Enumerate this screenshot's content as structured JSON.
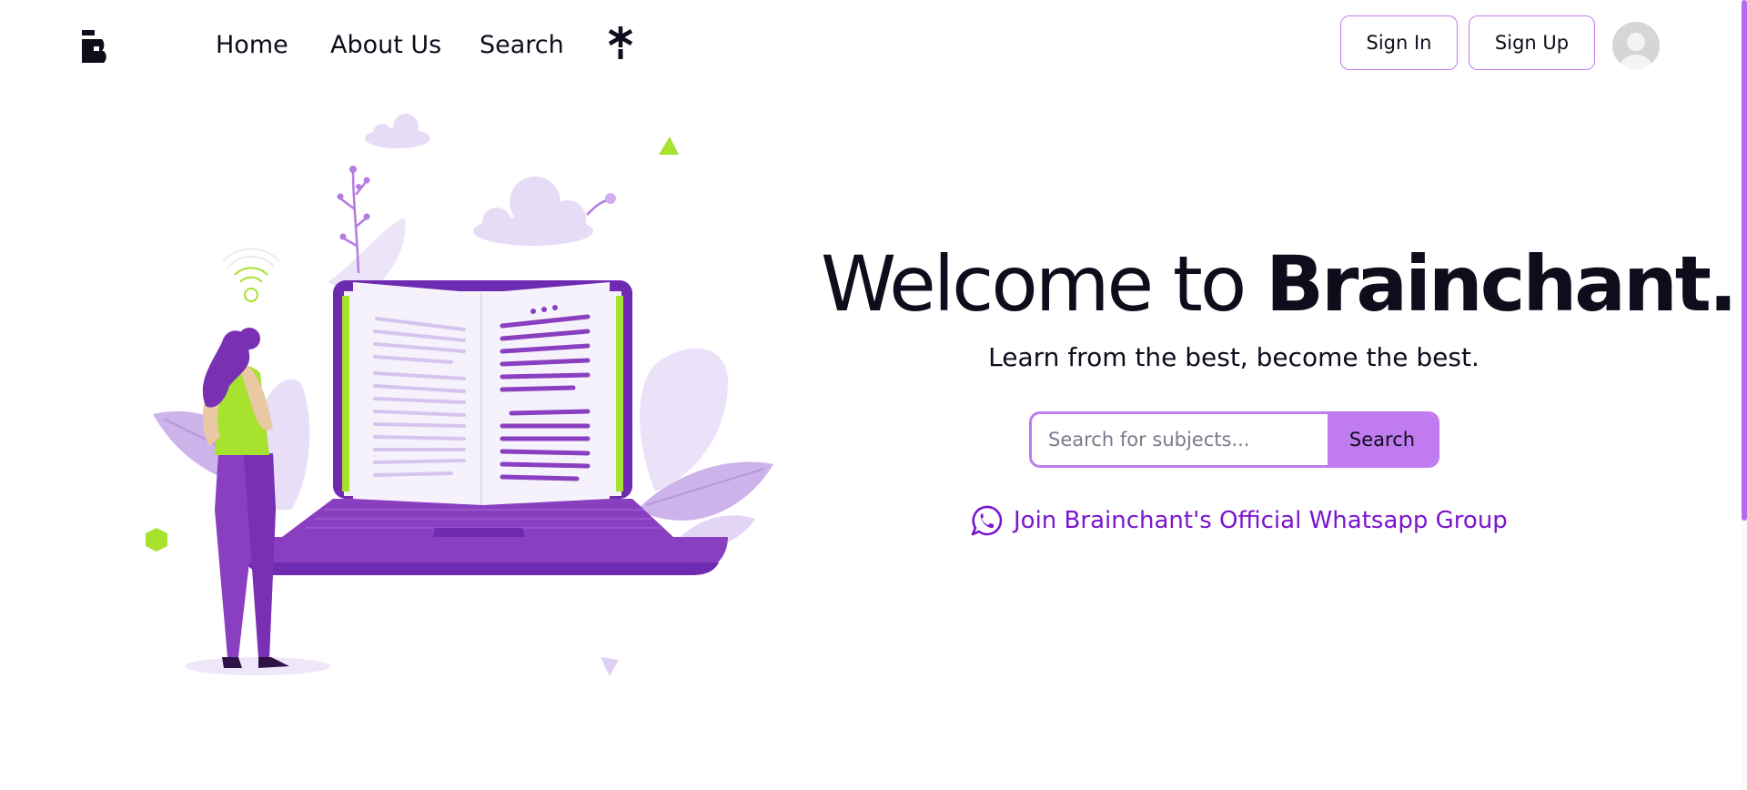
{
  "nav": {
    "home": "Home",
    "about": "About Us",
    "search": "Search"
  },
  "auth": {
    "sign_in": "Sign In",
    "sign_up": "Sign Up"
  },
  "hero": {
    "title_prefix": "Welcome to ",
    "title_brand": "Brainchant.",
    "subtitle": "Learn from the best, become the best.",
    "search_placeholder": "Search for subjects...",
    "search_button": "Search",
    "whatsapp_link": "Join Brainchant's Official Whatsapp Group"
  },
  "icons": {
    "logo": "brainchant-logo-icon",
    "asterisk": "asterisk-icon",
    "avatar": "user-avatar-icon",
    "whatsapp": "whatsapp-icon"
  },
  "colors": {
    "accent": "#c07bf0",
    "link": "#7b16cc",
    "text": "#0e0d1c",
    "laptop": "#8a3fc0",
    "lime": "#a6e22e"
  }
}
